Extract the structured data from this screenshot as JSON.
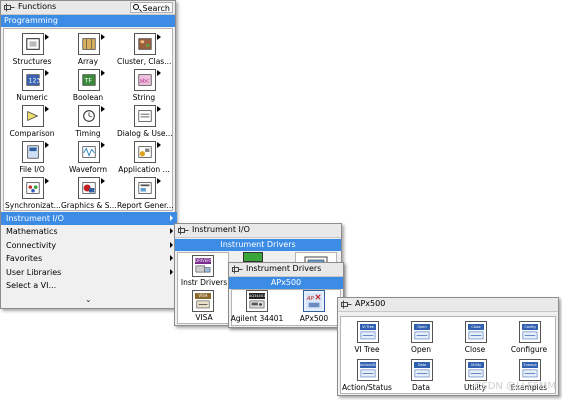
{
  "functions_palette": {
    "title": "Functions",
    "search_label": "Search",
    "category": "Programming",
    "items": [
      {
        "label": "Structures",
        "icon": "structures-icon"
      },
      {
        "label": "Array",
        "icon": "array-icon"
      },
      {
        "label": "Cluster, Clas...",
        "icon": "cluster-icon"
      },
      {
        "label": "Numeric",
        "icon": "numeric-icon"
      },
      {
        "label": "Boolean",
        "icon": "boolean-icon"
      },
      {
        "label": "String",
        "icon": "string-icon"
      },
      {
        "label": "Comparison",
        "icon": "comparison-icon"
      },
      {
        "label": "Timing",
        "icon": "timing-icon"
      },
      {
        "label": "Dialog & Use...",
        "icon": "dialog-icon"
      },
      {
        "label": "File I/O",
        "icon": "file-io-icon"
      },
      {
        "label": "Waveform",
        "icon": "waveform-icon"
      },
      {
        "label": "Application ...",
        "icon": "application-icon"
      },
      {
        "label": "Synchronizat...",
        "icon": "synchronization-icon"
      },
      {
        "label": "Graphics & S...",
        "icon": "graphics-icon"
      },
      {
        "label": "Report Gener...",
        "icon": "report-icon"
      }
    ],
    "menu": [
      {
        "label": "Instrument I/O",
        "selected": true
      },
      {
        "label": "Mathematics",
        "selected": false
      },
      {
        "label": "Connectivity",
        "selected": false
      },
      {
        "label": "Favorites",
        "selected": false
      },
      {
        "label": "User Libraries",
        "selected": false
      },
      {
        "label": "Select a VI...",
        "selected": false
      }
    ],
    "more_glyph": "⌄"
  },
  "instrument_io_palette": {
    "title": "Instrument I/O",
    "header": "Instrument Drivers",
    "items": [
      {
        "label": "Instr Drivers",
        "icon_text": "DRIVERS"
      },
      {
        "label": "VISA",
        "icon_text": "VISA"
      }
    ]
  },
  "instrument_drivers_palette": {
    "title": "Instrument Drivers",
    "header": "APx500",
    "items": [
      {
        "label": "Agilent 34401",
        "icon_text": "AG34401A"
      },
      {
        "label": "APx500",
        "icon_text": "AP"
      }
    ]
  },
  "apx500_palette": {
    "title": "APx500",
    "items": [
      {
        "label": "VI Tree",
        "icon_text": "VI Tree"
      },
      {
        "label": "Open",
        "icon_text": "Open"
      },
      {
        "label": "Close",
        "icon_text": "Close"
      },
      {
        "label": "Configure",
        "icon_text": "Config"
      },
      {
        "label": "Action/Status",
        "icon_text": "Action/Status"
      },
      {
        "label": "Data",
        "icon_text": "Data"
      },
      {
        "label": "Utility",
        "icon_text": "Utility"
      },
      {
        "label": "Examples",
        "icon_text": "Exampl"
      }
    ]
  },
  "watermark": "CSDN @LLFFMM",
  "colors": {
    "selection": "#3c8ce6",
    "panel_bg": "#f0f0f0",
    "tile_bg": "#ffffff"
  }
}
